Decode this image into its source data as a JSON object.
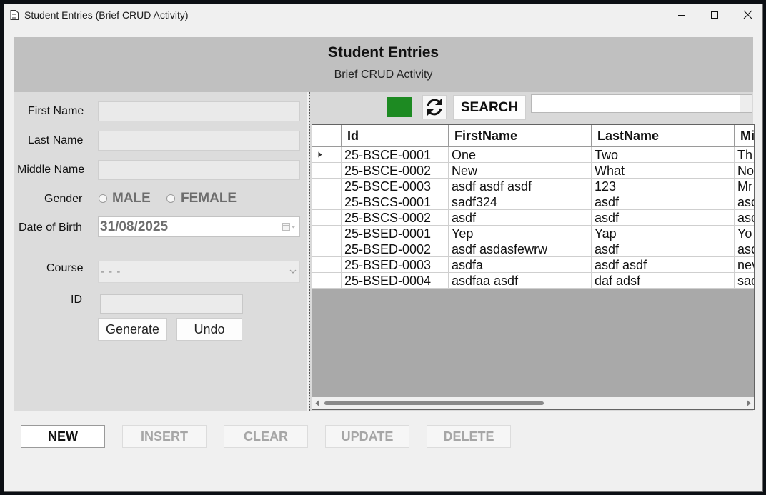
{
  "window": {
    "title": "Student Entries (Brief CRUD Activity)"
  },
  "header": {
    "title": "Student Entries",
    "subtitle": "Brief CRUD Activity"
  },
  "form": {
    "first_name_label": "First Name",
    "last_name_label": "Last Name",
    "middle_name_label": "Middle Name",
    "first_name_value": "",
    "last_name_value": "",
    "middle_name_value": "",
    "gender_label": "Gender",
    "gender_options": [
      "MALE",
      "FEMALE"
    ],
    "dob_label": "Date of Birth",
    "dob_value": "31/08/2025",
    "course_label": "Course",
    "course_value": "- - -",
    "id_label": "ID",
    "id_value": "",
    "generate_label": "Generate",
    "undo_label": "Undo"
  },
  "toolbar": {
    "search_label": "SEARCH",
    "search_value": "",
    "status_color": "#1d8a22"
  },
  "grid": {
    "columns": [
      "Id",
      "FirstName",
      "LastName",
      "Mi"
    ],
    "rows": [
      [
        "25-BSCE-0001",
        "One",
        "Two",
        "Th"
      ],
      [
        "25-BSCE-0002",
        "New",
        "What",
        "No"
      ],
      [
        "25-BSCE-0003",
        "asdf asdf asdf",
        "123",
        "Mr"
      ],
      [
        "25-BSCS-0001",
        "sadf324",
        "asdf",
        "asc"
      ],
      [
        "25-BSCS-0002",
        "asdf",
        "asdf",
        "asc"
      ],
      [
        "25-BSED-0001",
        "Yep",
        "Yap",
        "Yo"
      ],
      [
        "25-BSED-0002",
        "asdf asdasfewrw",
        "asdf",
        "asc"
      ],
      [
        "25-BSED-0003",
        "asdfa",
        "asdf asdf",
        "nev"
      ],
      [
        "25-BSED-0004",
        "asdfaa asdf",
        "daf adsf",
        "sad"
      ]
    ]
  },
  "actions": {
    "new": "NEW",
    "insert": "INSERT",
    "clear": "CLEAR",
    "update": "UPDATE",
    "delete": "DELETE"
  }
}
